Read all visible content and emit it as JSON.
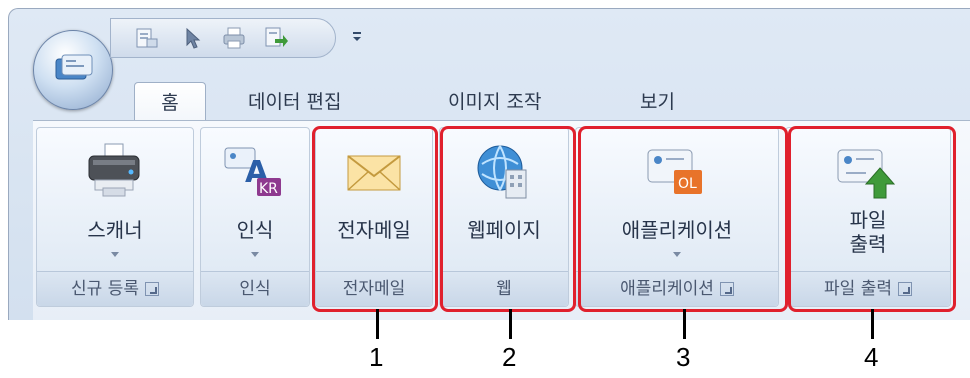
{
  "tabs": [
    {
      "label": "홈",
      "active": true
    },
    {
      "label": "데이터 편집",
      "active": false
    },
    {
      "label": "이미지 조작",
      "active": false
    },
    {
      "label": "보기",
      "active": false
    }
  ],
  "groups": [
    {
      "id": "new-registration",
      "button_label": "스캐너",
      "group_label": "신규 등록",
      "has_dropdown": true,
      "has_launcher": true
    },
    {
      "id": "recognition",
      "button_label": "인식",
      "group_label": "인식",
      "has_dropdown": true,
      "has_launcher": false
    },
    {
      "id": "email",
      "button_label": "전자메일",
      "group_label": "전자메일",
      "has_dropdown": false,
      "has_launcher": false
    },
    {
      "id": "web",
      "button_label": "웹페이지",
      "group_label": "웹",
      "has_dropdown": false,
      "has_launcher": false
    },
    {
      "id": "application",
      "button_label": "애플리케이션",
      "group_label": "애플리케이션",
      "has_dropdown": true,
      "has_launcher": true
    },
    {
      "id": "file-output",
      "button_label_line1": "파일",
      "button_label_line2": "출력",
      "group_label": "파일 출력",
      "has_dropdown": false,
      "has_launcher": true
    }
  ],
  "callouts": [
    "1",
    "2",
    "3",
    "4"
  ],
  "icons": {
    "recognition_badge": "KR",
    "application_badge": "OL"
  },
  "colors": {
    "highlight": "#e0202d",
    "accent_orange": "#e8732a",
    "accent_purple": "#8e3a8f",
    "arrow_green": "#3f9a3a"
  }
}
